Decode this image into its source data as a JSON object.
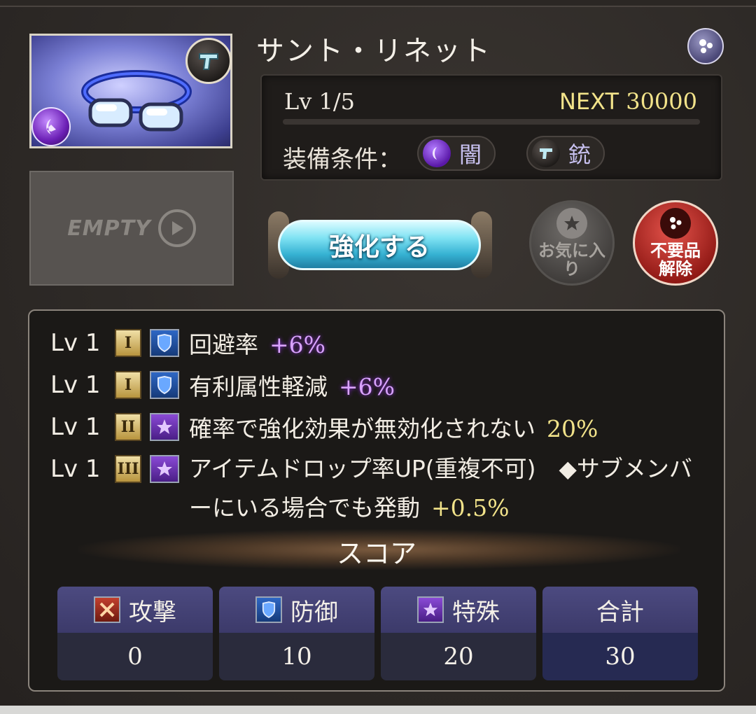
{
  "item": {
    "name": "サント・リネット",
    "level": "Lv 1/5",
    "next_label": "NEXT",
    "next_value": "30000",
    "exp_progress": 0.0,
    "equip_label": "装備条件：",
    "element_req": "闇",
    "weapon_req": "銃",
    "thumbnail_icon": "goggles-icon",
    "element_icon": "dark-element-icon",
    "weapon_icon": "gun-icon"
  },
  "empty_slot": {
    "label": "EMPTY"
  },
  "actions": {
    "enhance": "強化する",
    "favorite": "お気に入り",
    "unjunk_line1": "不要品",
    "unjunk_line2": "解除"
  },
  "skills": [
    {
      "lv": "Lv 1",
      "tier": "I",
      "type": "defense",
      "text": "回避率",
      "value": "+6%",
      "value_color": "purple"
    },
    {
      "lv": "Lv 1",
      "tier": "I",
      "type": "defense",
      "text": "有利属性軽減",
      "value": "+6%",
      "value_color": "purple"
    },
    {
      "lv": "Lv 1",
      "tier": "II",
      "type": "special",
      "text": "確率で強化効果が無効化されない",
      "value": "20%",
      "value_color": "yellow"
    },
    {
      "lv": "Lv 1",
      "tier": "III",
      "type": "special",
      "text": "アイテムドロップ率UP(重複不可)　◆サブメンバーにいる場合でも発動",
      "value": "+0.5%",
      "value_color": "yellow"
    }
  ],
  "score": {
    "title": "スコア",
    "attack": {
      "label": "攻撃",
      "value": "0"
    },
    "defense": {
      "label": "防御",
      "value": "10"
    },
    "special": {
      "label": "特殊",
      "value": "20"
    },
    "total": {
      "label": "合計",
      "value": "30"
    }
  },
  "colors": {
    "accent_purple": "#d9a3ff",
    "accent_yellow": "#f2e38a",
    "enhance_cyan": "#36b2d3",
    "junk_red": "#c62a22"
  }
}
